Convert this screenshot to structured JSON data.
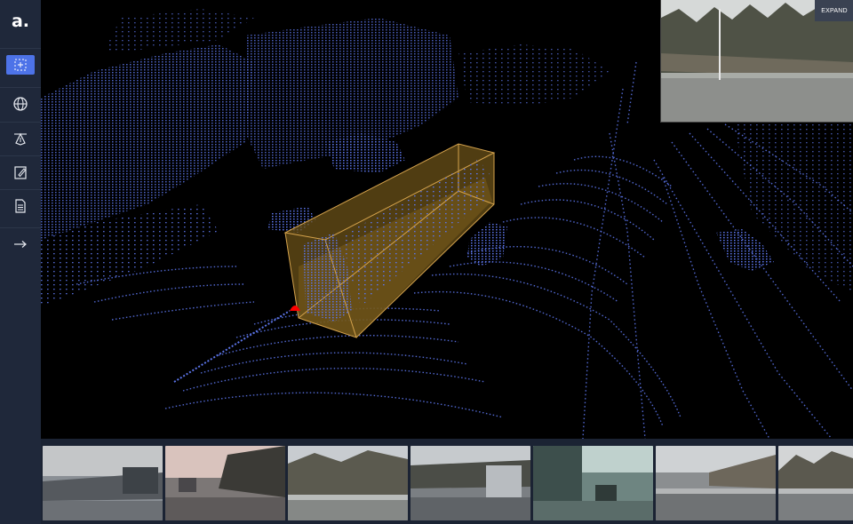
{
  "app": {
    "logo_text": "a",
    "logo_dot": "."
  },
  "sidebar": {
    "tools": [
      {
        "name": "box-select-icon",
        "active": true
      },
      {
        "name": "globe-icon",
        "active": false
      },
      {
        "name": "pen-tool-icon",
        "active": false
      },
      {
        "name": "edit-document-icon",
        "active": false
      },
      {
        "name": "document-icon",
        "active": false
      },
      {
        "name": "arrow-right-icon",
        "active": false
      }
    ]
  },
  "camera_preview": {
    "expand_label": "EXPAND"
  },
  "colors": {
    "point_cloud": "#5b74e8",
    "bounding_box": "#d4a24c",
    "bounding_box_fill": "#6b5218",
    "active_tool": "#4d73e8",
    "sidebar_bg": "#1f283a",
    "marker": "#ff0000"
  },
  "thumbnails": [
    {
      "name": "camera-thumbnail-1"
    },
    {
      "name": "camera-thumbnail-2"
    },
    {
      "name": "camera-thumbnail-3"
    },
    {
      "name": "camera-thumbnail-4"
    },
    {
      "name": "camera-thumbnail-5"
    },
    {
      "name": "camera-thumbnail-6"
    },
    {
      "name": "camera-thumbnail-7"
    }
  ]
}
